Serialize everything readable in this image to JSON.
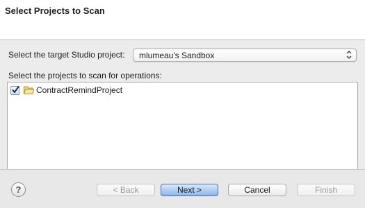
{
  "dialog": {
    "title": "Select Projects to Scan"
  },
  "target": {
    "label": "Select the target Studio project:",
    "selected": "mlumeau's Sandbox"
  },
  "projects": {
    "label": "Select the projects to scan for operations:",
    "items": [
      {
        "label": "ContractRemindProject",
        "checked": true
      }
    ]
  },
  "buttons": {
    "help": "?",
    "back": "< Back",
    "next": "Next >",
    "cancel": "Cancel",
    "finish": "Finish"
  },
  "icons": {
    "folder": "folder-icon",
    "help": "help-icon",
    "checkbox": "checkbox-checked-icon"
  }
}
